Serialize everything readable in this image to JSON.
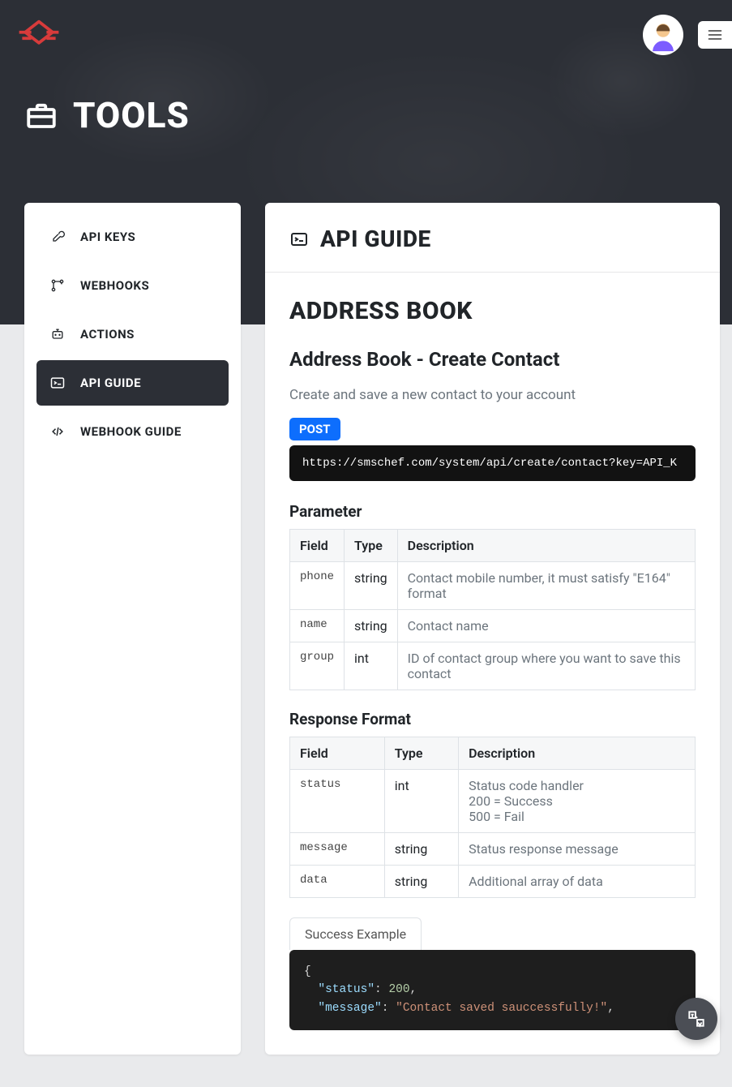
{
  "page": {
    "title": "TOOLS"
  },
  "sidebar": {
    "items": [
      {
        "id": "api-keys",
        "label": "API KEYS"
      },
      {
        "id": "webhooks",
        "label": "WEBHOOKS"
      },
      {
        "id": "actions",
        "label": "ACTIONS"
      },
      {
        "id": "api-guide",
        "label": "API GUIDE"
      },
      {
        "id": "webhook-guide",
        "label": "WEBHOOK GUIDE"
      }
    ],
    "activeIndex": 3
  },
  "main": {
    "heading": "API GUIDE",
    "section_title": "ADDRESS BOOK",
    "subsection": "Address Book - Create Contact",
    "lead": "Create and save a new contact to your account",
    "method_badge": "POST",
    "endpoint": "https://smschef.com/system/api/create/contact?key=API_K",
    "parameter_title": "Parameter",
    "param_headers": {
      "field": "Field",
      "type": "Type",
      "desc": "Description"
    },
    "parameters": [
      {
        "field": "phone",
        "type": "string",
        "desc": "Contact mobile number, it must satisfy \"E164\" format"
      },
      {
        "field": "name",
        "type": "string",
        "desc": "Contact name"
      },
      {
        "field": "group",
        "type": "int",
        "desc": "ID of contact group where you want to save this contact"
      }
    ],
    "response_title": "Response Format",
    "response_headers": {
      "field": "Field",
      "type": "Type",
      "desc": "Description"
    },
    "responses": [
      {
        "field": "status",
        "type": "int",
        "desc": "Status code handler\n200 = Success\n500 = Fail"
      },
      {
        "field": "message",
        "type": "string",
        "desc": "Status response message"
      },
      {
        "field": "data",
        "type": "string",
        "desc": "Additional array of data"
      }
    ],
    "example_tab": "Success Example",
    "example_json": {
      "lines": [
        {
          "indent": 0,
          "type": "punc",
          "text": "{"
        },
        {
          "indent": 1,
          "key": "\"status\"",
          "punc1": ": ",
          "valType": "num",
          "val": "200",
          "punc2": ","
        },
        {
          "indent": 1,
          "key": "\"message\"",
          "punc1": ": ",
          "valType": "str",
          "val": "\"Contact saved sauccessfully!\"",
          "punc2": ","
        }
      ]
    }
  }
}
